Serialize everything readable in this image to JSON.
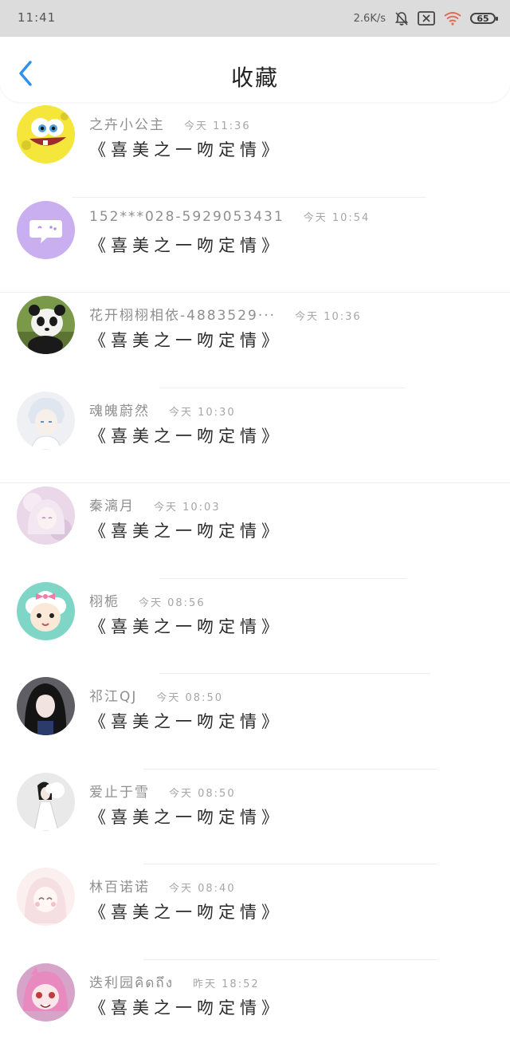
{
  "status_bar": {
    "time": "11:41",
    "net_speed": "2.6K/s",
    "battery": "65"
  },
  "header": {
    "title": "收藏",
    "accent_color": "#2f8fea"
  },
  "favorites": [
    {
      "name": "之卉小公主",
      "time": "今天 11:36",
      "message": "《喜美之一吻定情》",
      "avatar": "spongebob-avatar"
    },
    {
      "name": "152***028-5929053431",
      "time": "今天 10:54",
      "message": "《喜美之一吻定情》",
      "avatar": "chat-bubble-avatar"
    },
    {
      "name": "花开栩栩相依-4883529···",
      "time": "今天 10:36",
      "message": "《喜美之一吻定情》",
      "avatar": "panda-avatar"
    },
    {
      "name": "魂魄蔚然",
      "time": "今天 10:30",
      "message": "《喜美之一吻定情》",
      "avatar": "anime-boy-avatar"
    },
    {
      "name": "秦漓月",
      "time": "今天 10:03",
      "message": "《喜美之一吻定情》",
      "avatar": "anime-girl-avatar"
    },
    {
      "name": "栩栀",
      "time": "今天 08:56",
      "message": "《喜美之一吻定情》",
      "avatar": "sheep-avatar"
    },
    {
      "name": "祁江QJ",
      "time": "今天 08:50",
      "message": "《喜美之一吻定情》",
      "avatar": "dark-hair-avatar"
    },
    {
      "name": "爱止于雪",
      "time": "今天 08:50",
      "message": "《喜美之一吻定情》",
      "avatar": "white-dress-avatar"
    },
    {
      "name": "林百诺诺",
      "time": "今天 08:40",
      "message": "《喜美之一吻定情》",
      "avatar": "pink-hair-avatar"
    },
    {
      "name": "迭利园คิดถึง",
      "time": "昨天 18:52",
      "message": "《喜美之一吻定情》",
      "avatar": "pink-anime-avatar"
    }
  ]
}
